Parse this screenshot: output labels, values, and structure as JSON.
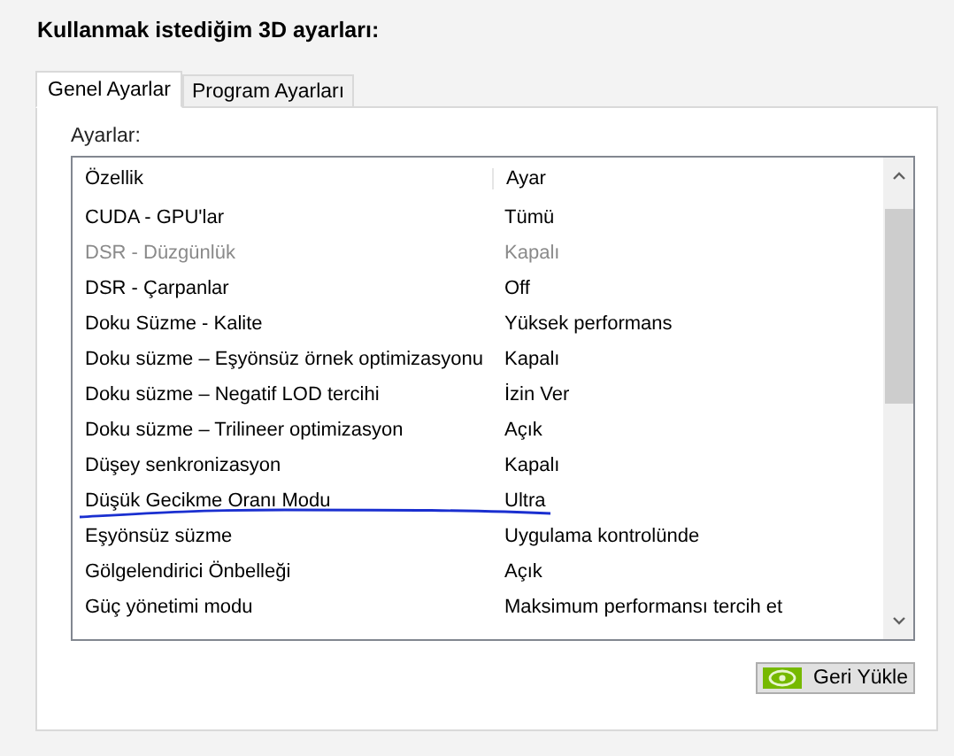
{
  "heading": "Kullanmak istediğim 3D ayarları:",
  "tabs": [
    {
      "label": "Genel Ayarlar",
      "selected": true
    },
    {
      "label": "Program Ayarları",
      "selected": false
    }
  ],
  "list_label": "Ayarlar:",
  "table": {
    "columns": [
      "Özellik",
      "Ayar"
    ],
    "rows": [
      {
        "feature": "CUDA - GPU'lar",
        "setting": "Tümü",
        "disabled": false
      },
      {
        "feature": "DSR - Düzgünlük",
        "setting": "Kapalı",
        "disabled": true
      },
      {
        "feature": "DSR - Çarpanlar",
        "setting": "Off",
        "disabled": false
      },
      {
        "feature": "Doku Süzme - Kalite",
        "setting": "Yüksek performans",
        "disabled": false
      },
      {
        "feature": "Doku süzme – Eşyönsüz örnek optimizasyonu",
        "setting": "Kapalı",
        "disabled": false
      },
      {
        "feature": "Doku süzme – Negatif LOD tercihi",
        "setting": "İzin Ver",
        "disabled": false
      },
      {
        "feature": "Doku süzme – Trilineer optimizasyon",
        "setting": "Açık",
        "disabled": false
      },
      {
        "feature": "Düşey senkronizasyon",
        "setting": "Kapalı",
        "disabled": false
      },
      {
        "feature": "Düşük Gecikme Oranı Modu",
        "setting": "Ultra",
        "disabled": false
      },
      {
        "feature": "Eşyönsüz süzme",
        "setting": "Uygulama kontrolünde",
        "disabled": false
      },
      {
        "feature": "Gölgelendirici Önbelleği",
        "setting": "Açık",
        "disabled": false
      },
      {
        "feature": "Güç yönetimi modu",
        "setting": "Maksimum performansı tercih et",
        "disabled": false
      }
    ]
  },
  "restore_button": "Geri Yükle"
}
